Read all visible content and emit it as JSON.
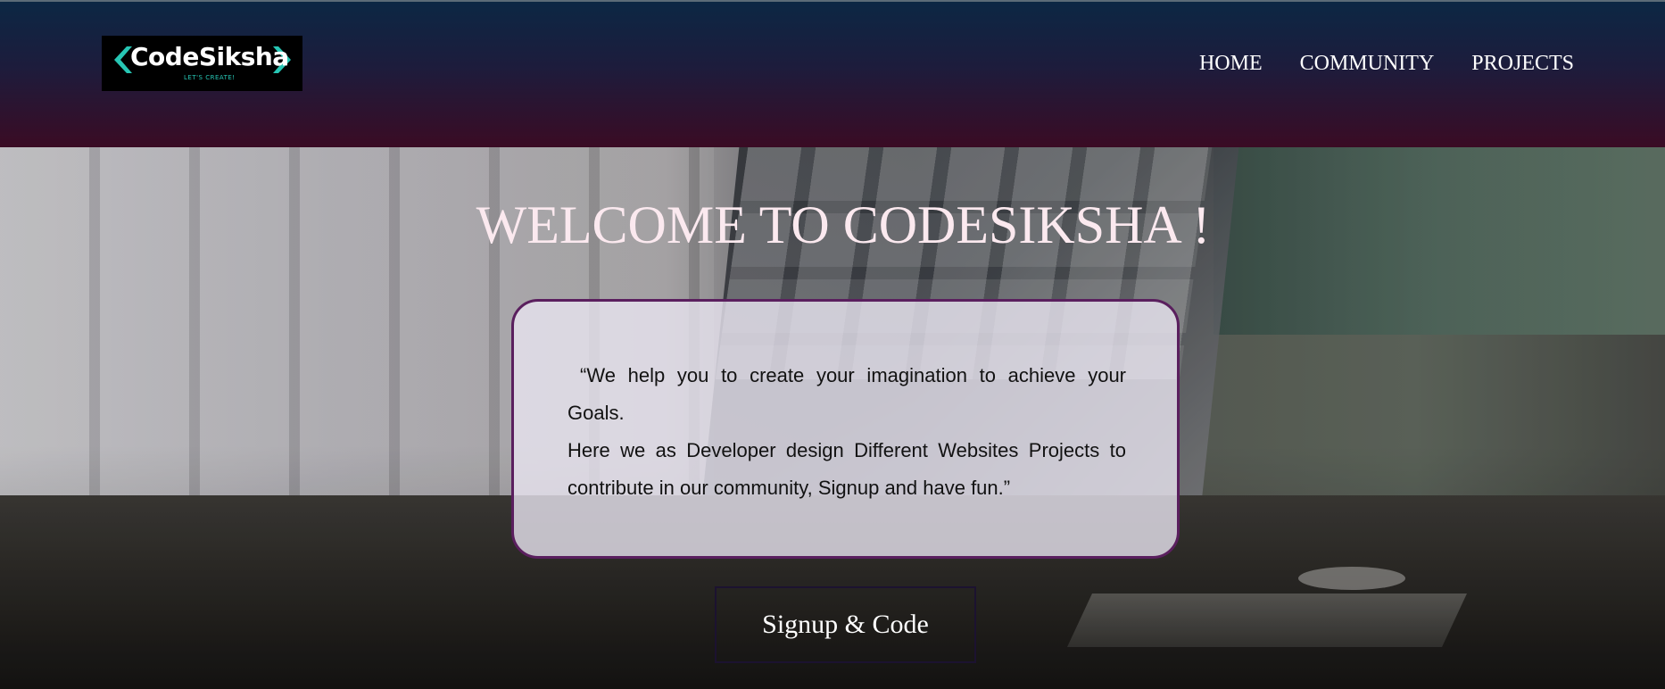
{
  "header": {
    "logo": {
      "word": "CodeSiksha",
      "tagline": "LET'S CREATE!"
    },
    "nav": [
      {
        "label": "HOME"
      },
      {
        "label": "COMMUNITY"
      },
      {
        "label": "PROJECTS"
      }
    ]
  },
  "hero": {
    "title": "WELCOME TO CODESIKSHA !",
    "quote_line1": "“We help you to create your imagination to achieve your Goals.",
    "quote_line2": "Here we as Developer design Different Websites Projects to contribute in our community, Signup and have fun.”",
    "cta_label": "Signup & Code"
  },
  "colors": {
    "header_top": "#0c2744",
    "header_bottom": "#3a0b24",
    "logo_accent": "#27c6b4",
    "title_color": "#fbe9ef",
    "box_border": "#5a1f5e"
  }
}
